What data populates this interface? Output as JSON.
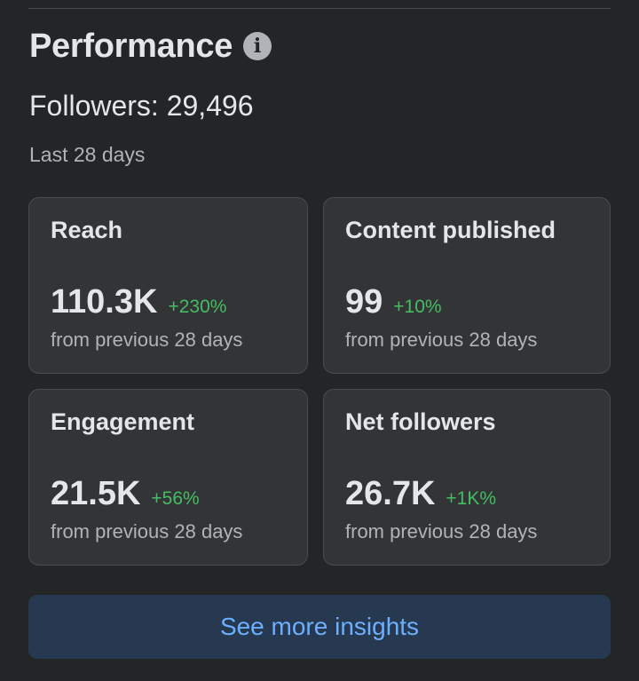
{
  "header": {
    "title": "Performance",
    "info_icon": "info-icon",
    "info_glyph": "i"
  },
  "followers": {
    "text": "Followers: 29,496"
  },
  "period": {
    "text": "Last 28 days"
  },
  "cards": [
    {
      "label": "Reach",
      "value": "110.3K",
      "change": "+230%",
      "sub": "from previous 28 days"
    },
    {
      "label": "Content published",
      "value": "99",
      "change": "+10%",
      "sub": "from previous 28 days"
    },
    {
      "label": "Engagement",
      "value": "21.5K",
      "change": "+56%",
      "sub": "from previous 28 days"
    },
    {
      "label": "Net followers",
      "value": "26.7K",
      "change": "+1K%",
      "sub": "from previous 28 days"
    }
  ],
  "actions": {
    "see_more": "See more insights"
  },
  "colors": {
    "background": "#242526",
    "card": "#333436",
    "positive": "#45bd62",
    "link": "#6dafff",
    "button_bg": "#263951"
  }
}
